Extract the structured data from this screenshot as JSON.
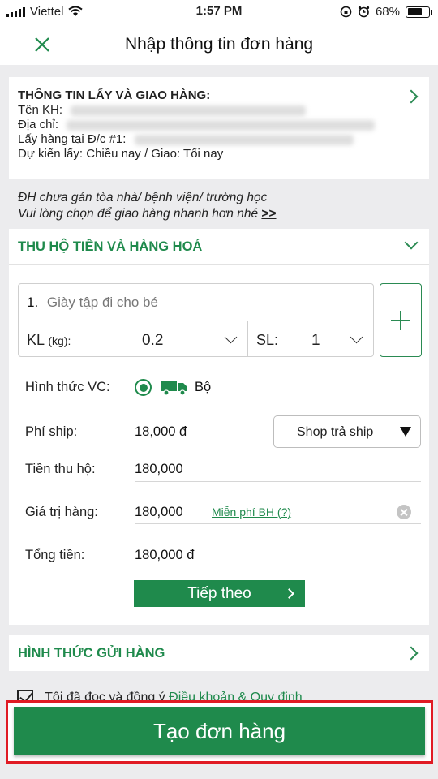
{
  "status_bar": {
    "carrier": "Viettel",
    "time": "1:57 PM",
    "battery": "68%"
  },
  "header": {
    "title": "Nhập thông tin đơn hàng"
  },
  "pickup_info": {
    "heading": "THÔNG TIN LẤY VÀ GIAO HÀNG:",
    "customer_label": "Tên KH:",
    "address_label": "Địa chỉ:",
    "pickup_label": "Lấy hàng tại Đ/c #1:",
    "schedule": "Dự kiến lấy: Chiều nay / Giao: Tối nay"
  },
  "notice": {
    "line1": "ĐH chưa gán tòa nhà/ bệnh viện/ trường học",
    "line2": "Vui lòng chọn để giao hàng nhanh hơn nhé",
    "link": ">>"
  },
  "cod_section": {
    "title": "THU HỘ TIỀN VÀ HÀNG HOÁ",
    "product": {
      "index": "1.",
      "placeholder": "Giày tập đi cho bé",
      "weight_label": "KL",
      "weight_unit": "(kg):",
      "weight_value": "0.2",
      "qty_label": "SL:",
      "qty_value": "1"
    },
    "transport": {
      "label": "Hình thức VC:",
      "value": "Bộ"
    },
    "ship_fee": {
      "label": "Phí ship:",
      "value": "18,000 đ",
      "payer": "Shop trả ship"
    },
    "cod": {
      "label": "Tiền thu hộ:",
      "value": "180,000"
    },
    "goods_value": {
      "label": "Giá trị hàng:",
      "value": "180,000",
      "insurance_link": "Miễn phí BH (?)"
    },
    "total": {
      "label": "Tổng tiền:",
      "value": "180,000 đ"
    },
    "next_button": "Tiếp theo"
  },
  "send_method": {
    "title": "HÌNH THỨC GỬI HÀNG"
  },
  "agreement": {
    "text": "Tôi đã đọc và đồng ý",
    "link": "Điều khoản & Quy định"
  },
  "create_button": "Tạo đơn hàng",
  "colors": {
    "brand_green": "#1f8a4c",
    "highlight_red": "#e01b24"
  }
}
